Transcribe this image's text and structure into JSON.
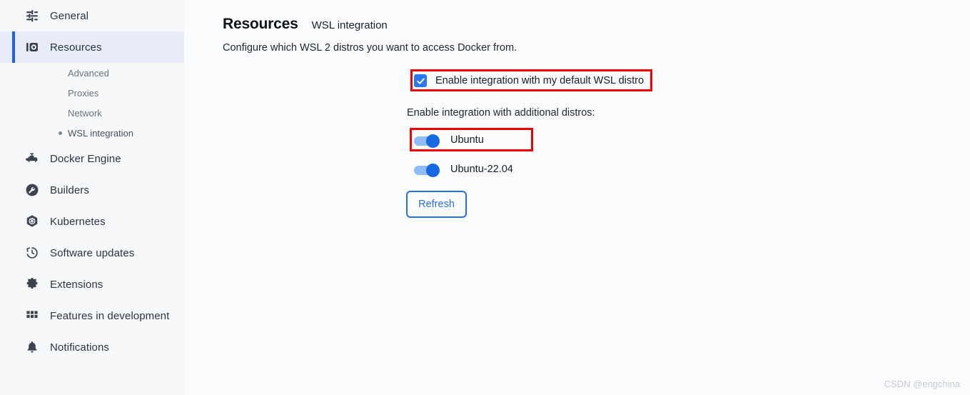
{
  "sidebar": {
    "items": [
      {
        "id": "general",
        "label": "General",
        "icon": "sliders-icon",
        "active": false
      },
      {
        "id": "resources",
        "label": "Resources",
        "icon": "resources-icon",
        "active": true
      },
      {
        "id": "docker-engine",
        "label": "Docker Engine",
        "icon": "engine-icon",
        "active": false
      },
      {
        "id": "builders",
        "label": "Builders",
        "icon": "wrench-circle-icon",
        "active": false
      },
      {
        "id": "kubernetes",
        "label": "Kubernetes",
        "icon": "kubernetes-icon",
        "active": false
      },
      {
        "id": "software-updates",
        "label": "Software updates",
        "icon": "history-clock-icon",
        "active": false
      },
      {
        "id": "extensions",
        "label": "Extensions",
        "icon": "puzzle-icon",
        "active": false
      },
      {
        "id": "features-in-development",
        "label": "Features in development",
        "icon": "grid-icon",
        "active": false
      },
      {
        "id": "notifications",
        "label": "Notifications",
        "icon": "bell-icon",
        "active": false
      }
    ],
    "sub_items": [
      {
        "id": "advanced",
        "label": "Advanced",
        "current": false
      },
      {
        "id": "proxies",
        "label": "Proxies",
        "current": false
      },
      {
        "id": "network",
        "label": "Network",
        "current": false
      },
      {
        "id": "wsl-integration",
        "label": "WSL integration",
        "current": true
      }
    ]
  },
  "header": {
    "title": "Resources",
    "subtitle": "WSL integration",
    "description": "Configure which WSL 2 distros you want to access Docker from."
  },
  "default_distro": {
    "label": "Enable integration with my default WSL distro",
    "checked": true
  },
  "additional": {
    "label": "Enable integration with additional distros:",
    "distros": [
      {
        "name": "Ubuntu",
        "enabled": true
      },
      {
        "name": "Ubuntu-22.04",
        "enabled": true
      }
    ]
  },
  "actions": {
    "refresh_label": "Refresh"
  },
  "watermark": "CSDN @engchina",
  "colors": {
    "accent": "#1668e3",
    "checkbox": "#2a77ef",
    "toggle_track": "#8fbcf7",
    "toggle_knob": "#1668e3",
    "annotation": "#f00000",
    "active_nav_bg": "#e7ecf8",
    "background": "#f7f8fa"
  }
}
